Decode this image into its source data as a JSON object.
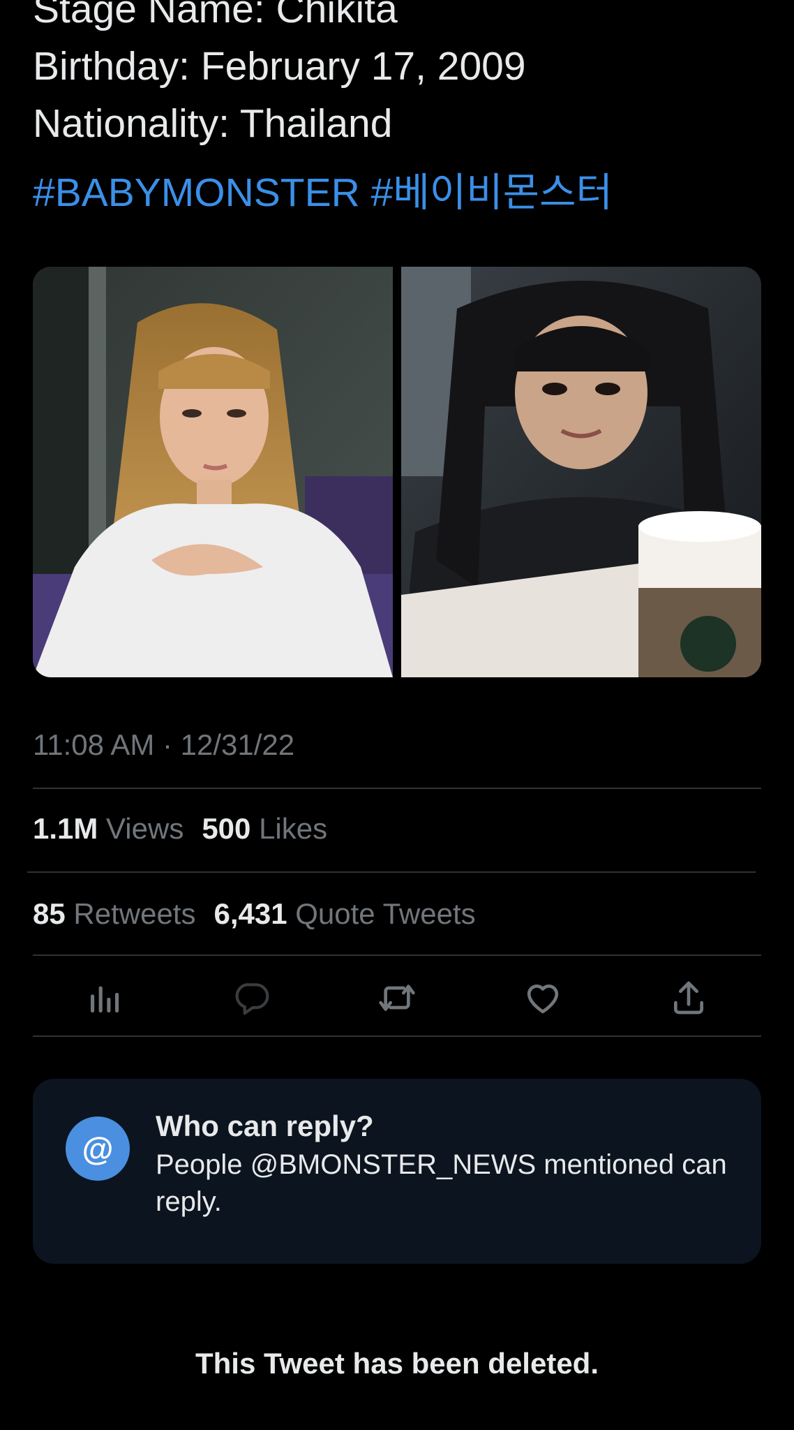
{
  "tweet": {
    "lines": [
      "Stage Name: Chikita",
      "Birthday: February 17, 2009",
      "Nationality: Thailand"
    ],
    "hashtags": [
      "#BABYMONSTER",
      "#베이비몬스터"
    ],
    "timestamp": "11:08 AM · 12/31/22"
  },
  "media": {
    "photos": [
      {
        "name": "photo-blonde-girl-white-tshirt"
      },
      {
        "name": "photo-girl-braids-coffee-cup"
      }
    ]
  },
  "stats": {
    "views_num": "1.1M",
    "views_label": "Views",
    "likes_num": "500",
    "likes_label": "Likes",
    "retweets_num": "85",
    "retweets_label": "Retweets",
    "quotes_num": "6,431",
    "quotes_label": "Quote Tweets"
  },
  "actions": [
    {
      "icon": "analytics-icon"
    },
    {
      "icon": "reply-icon"
    },
    {
      "icon": "retweet-icon"
    },
    {
      "icon": "like-icon"
    },
    {
      "icon": "share-icon"
    }
  ],
  "reply_restriction": {
    "badge": "@",
    "title": "Who can reply?",
    "description": "People @BMONSTER_NEWS mentioned can reply."
  },
  "deleted_notice": "This Tweet has been deleted.",
  "colors": {
    "background": "#000000",
    "text": "#e7e9ea",
    "secondary_text": "#71767b",
    "link": "#3b8fe8",
    "divider": "#2f3336",
    "card_bg": "#0b141f",
    "accent": "#4a8fe0"
  }
}
